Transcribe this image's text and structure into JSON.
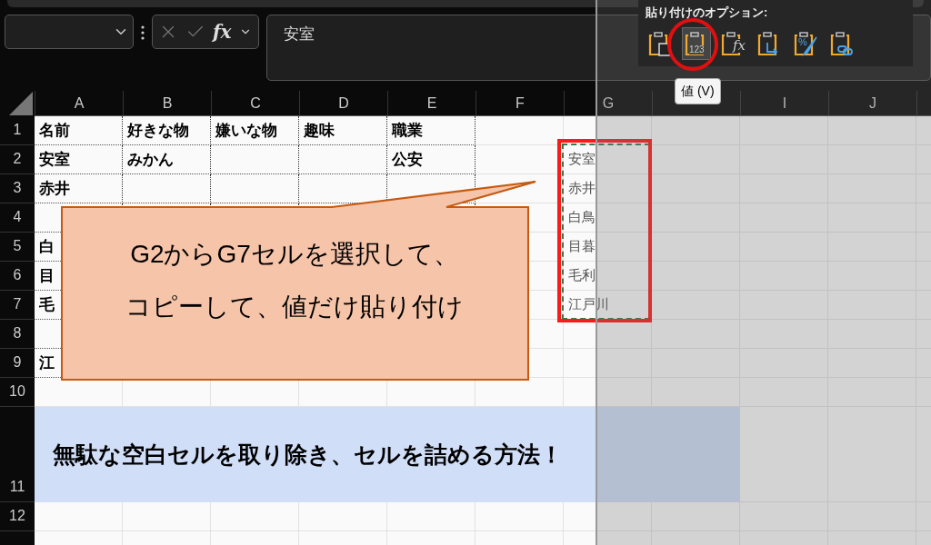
{
  "formula_bar": {
    "function_label": "fx",
    "value": "安室"
  },
  "columns": [
    "A",
    "B",
    "C",
    "D",
    "E",
    "F",
    "G",
    null,
    "I",
    "J"
  ],
  "rows": [
    {
      "number": "1",
      "kind": "cells",
      "cells": [
        {
          "text": "名前",
          "bold": true
        },
        {
          "text": "好きな物",
          "bold": true
        },
        {
          "text": "嫌いな物",
          "bold": true
        },
        {
          "text": "趣味",
          "bold": true
        },
        {
          "text": "職業",
          "bold": true
        }
      ]
    },
    {
      "number": "2",
      "kind": "cells",
      "cells": [
        {
          "text": "安室",
          "bold": true
        },
        {
          "text": "みかん",
          "bold": true
        },
        null,
        null,
        {
          "text": "公安",
          "bold": true
        },
        null,
        {
          "text": "安室",
          "bold": false
        }
      ]
    },
    {
      "number": "3",
      "kind": "cells",
      "cells": [
        {
          "text": "赤井",
          "bold": true
        },
        null,
        null,
        null,
        null,
        null,
        {
          "text": "赤井",
          "bold": false
        }
      ]
    },
    {
      "number": "4",
      "kind": "cells",
      "cells": [
        null,
        null,
        null,
        null,
        null,
        null,
        {
          "text": "白鳥",
          "bold": false
        }
      ]
    },
    {
      "number": "5",
      "kind": "cells",
      "cells": [
        {
          "text": "白",
          "bold": true
        },
        null,
        null,
        null,
        null,
        null,
        {
          "text": "目暮",
          "bold": false
        }
      ]
    },
    {
      "number": "6",
      "kind": "cells",
      "cells": [
        {
          "text": "目",
          "bold": true
        },
        null,
        null,
        null,
        null,
        null,
        {
          "text": "毛利",
          "bold": false
        }
      ]
    },
    {
      "number": "7",
      "kind": "cells",
      "cells": [
        {
          "text": "毛",
          "bold": true
        },
        null,
        null,
        null,
        null,
        null,
        {
          "text": "江戸川",
          "bold": false
        }
      ]
    },
    {
      "number": "8",
      "kind": "cells",
      "cells": []
    },
    {
      "number": "9",
      "kind": "cells",
      "cells": [
        {
          "text": "江",
          "bold": true
        }
      ]
    },
    {
      "number": "10",
      "kind": "cells",
      "cells": []
    },
    {
      "number": "11",
      "kind": "banner",
      "text": "無駄な空白セルを取り除き、セルを詰める方法！"
    },
    {
      "number": "12",
      "kind": "cells",
      "cells": []
    }
  ],
  "callout": {
    "lines": [
      "G2からG7セルを選択して、",
      "コピーして、値だけ貼り付け"
    ]
  },
  "paste_options": {
    "title": "貼り付けのオプション:",
    "options": [
      {
        "kind": "paste",
        "selected": false
      },
      {
        "kind": "values",
        "selected": true,
        "glyph": "123"
      },
      {
        "kind": "formulas",
        "selected": false,
        "glyph": "fx"
      },
      {
        "kind": "transpose",
        "selected": false
      },
      {
        "kind": "formatting",
        "selected": false,
        "glyph": "%"
      },
      {
        "kind": "link",
        "selected": false
      }
    ],
    "tooltip": "値 (V)"
  }
}
